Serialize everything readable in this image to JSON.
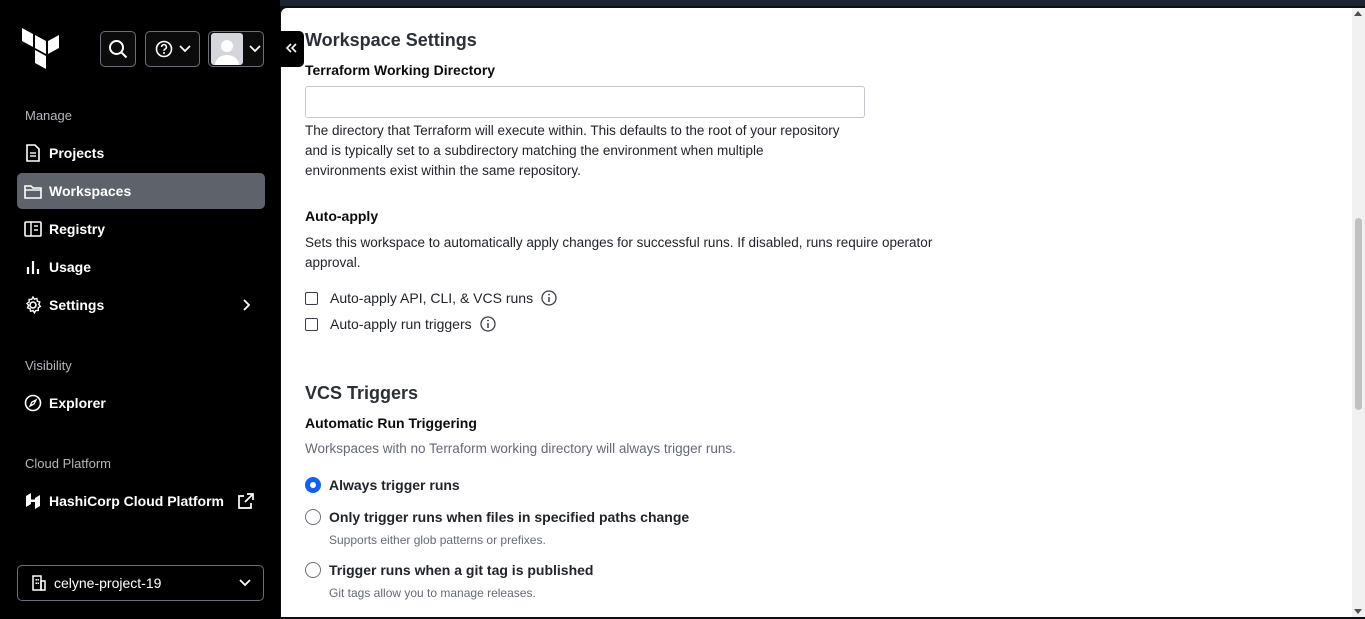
{
  "sidebar": {
    "header": {
      "logo_icon": "terraform-logo-icon",
      "search_icon": "search-icon",
      "help_icon": "help-icon",
      "user_icon": "avatar"
    },
    "sections": [
      {
        "label": "Manage"
      },
      {
        "label": "Visibility"
      },
      {
        "label": "Cloud Platform"
      }
    ],
    "items": [
      {
        "label": "Projects",
        "icon": "file-icon"
      },
      {
        "label": "Workspaces",
        "icon": "folder-icon"
      },
      {
        "label": "Registry",
        "icon": "registry-icon"
      },
      {
        "label": "Usage",
        "icon": "bar-chart-icon"
      },
      {
        "label": "Settings",
        "icon": "gear-icon"
      },
      {
        "label": "Explorer",
        "icon": "compass-icon"
      },
      {
        "label": "HashiCorp Cloud Platform",
        "icon": "hashicorp-icon"
      }
    ],
    "organization": "celyne-project-19"
  },
  "main": {
    "workspace_settings": {
      "title": "Workspace Settings",
      "working_dir_label": "Terraform Working Directory",
      "working_dir_value": "",
      "working_dir_help": [
        "The directory that Terraform will execute within. This defaults to the root of your repository",
        "and is typically set to a subdirectory matching the environment when multiple",
        "environments exist within the same repository."
      ],
      "auto_apply_label": "Auto-apply",
      "auto_apply_help": [
        "Sets this workspace to automatically apply changes for successful runs. If disabled, runs require operator",
        "approval."
      ],
      "checkboxes": [
        {
          "label": "Auto-apply API, CLI, & VCS runs",
          "checked": false
        },
        {
          "label": "Auto-apply run triggers",
          "checked": false
        }
      ]
    },
    "vcs_triggers": {
      "title": "VCS Triggers",
      "subtitle": "Automatic Run Triggering",
      "help": "Workspaces with no Terraform working directory will always trigger runs.",
      "options": [
        {
          "label": "Always trigger runs",
          "selected": true,
          "help": ""
        },
        {
          "label": "Only trigger runs when files in specified paths change",
          "selected": false,
          "help": "Supports either glob patterns or prefixes."
        },
        {
          "label": "Trigger runs when a git tag is published",
          "selected": false,
          "help": "Git tags allow you to manage releases."
        }
      ]
    }
  },
  "colors": {
    "sidebar_bg": "#000000",
    "active_item_bg": "#5e636b",
    "radio_selected": "#1060ff",
    "help_text": "#656a76"
  }
}
